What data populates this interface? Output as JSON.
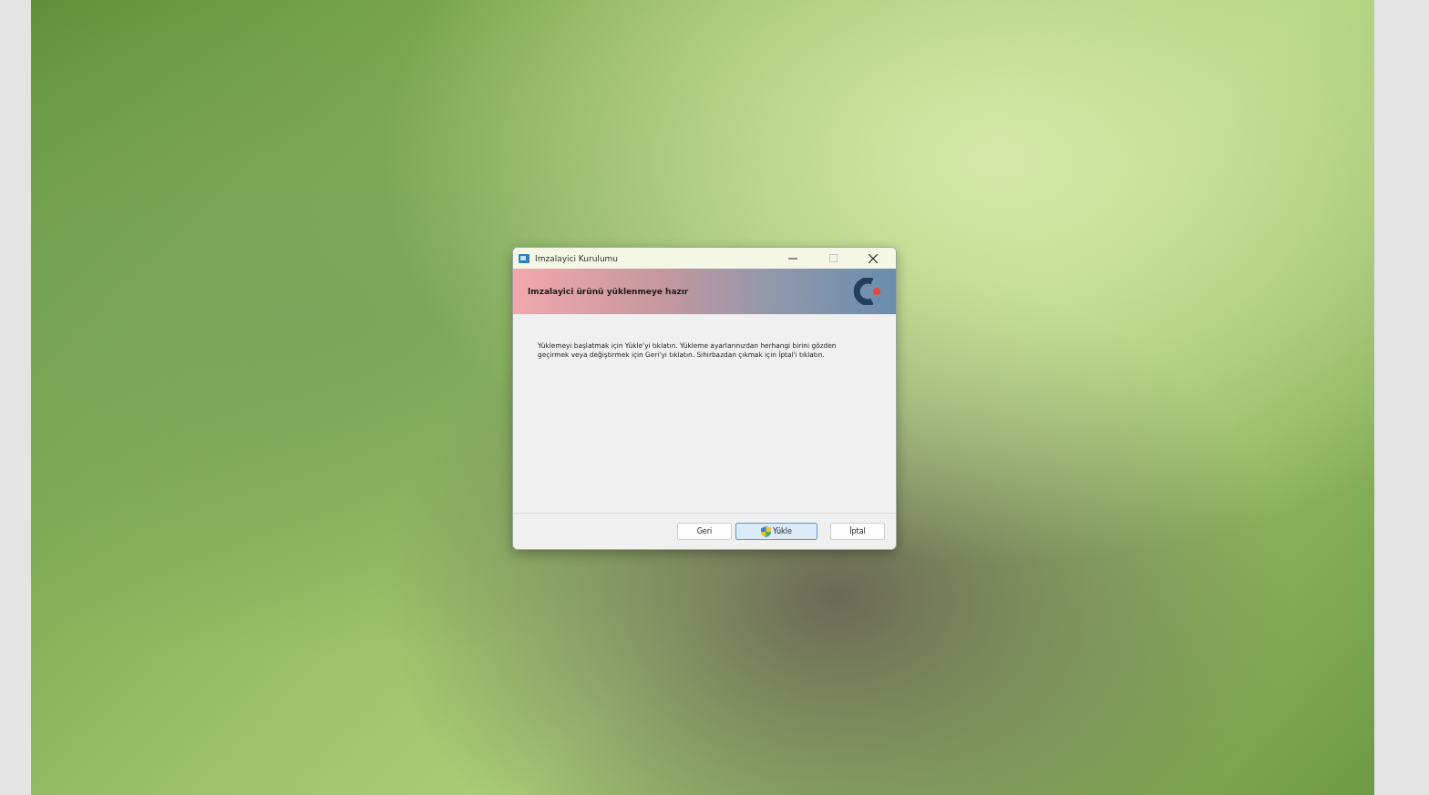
{
  "window": {
    "title": "Imzalayici Kurulumu"
  },
  "header": {
    "title": "Imzalayici ürünü yüklenmeye hazır"
  },
  "body": {
    "text": "Yüklemeyi başlatmak için Yükle'yi tıklatın. Yükleme ayarlarınızdan herhangi birini gözden geçirmek veya değiştirmek için Geri'yi tıklatın. Sihirbazdan çıkmak için İptal'i tıklatın."
  },
  "buttons": [
    {
      "label": "Geri",
      "default": false,
      "shield": false
    },
    {
      "label": "Yükle",
      "default": true,
      "shield": true
    },
    {
      "label": "İptal",
      "default": false,
      "shield": false
    }
  ]
}
